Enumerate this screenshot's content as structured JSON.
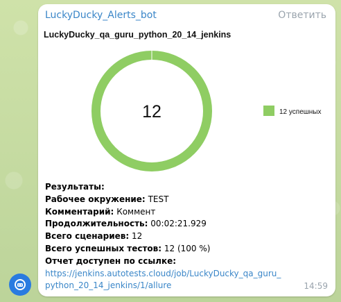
{
  "message": {
    "sender": "LuckyDucky_Alerts_bot",
    "reply_label": "Ответить",
    "time": "14:59"
  },
  "results": {
    "heading": "Результаты:",
    "env_label": "Рабочее окружение:",
    "env_value": "TEST",
    "comment_label": "Комментарий:",
    "comment_value": "Коммент",
    "duration_label": "Продолжительность:",
    "duration_value": "00:02:21.929",
    "scenarios_label": "Всего сценариев:",
    "scenarios_value": "12",
    "passed_label": "Всего успешных тестов:",
    "passed_value": "12 (100 %)",
    "report_label": "Отчет доступен по ссылке:",
    "report_url": "https://jenkins.autotests.cloud/job/LuckyDucky_qa_guru_python_20_14_jenkins/1/allure"
  },
  "chart_data": {
    "type": "pie",
    "title": "LuckyDucky_qa_guru_python_20_14_jenkins",
    "center_label": "12",
    "slices": [
      {
        "label": "12 успешных",
        "value": 12,
        "color": "#8fcd63"
      }
    ],
    "legend_position": "right"
  },
  "colors": {
    "accent": "#3a86c8",
    "passed": "#8fcd63",
    "avatar": "#2a7be0"
  },
  "icons": {
    "avatar": "bot-avatar-icon"
  }
}
